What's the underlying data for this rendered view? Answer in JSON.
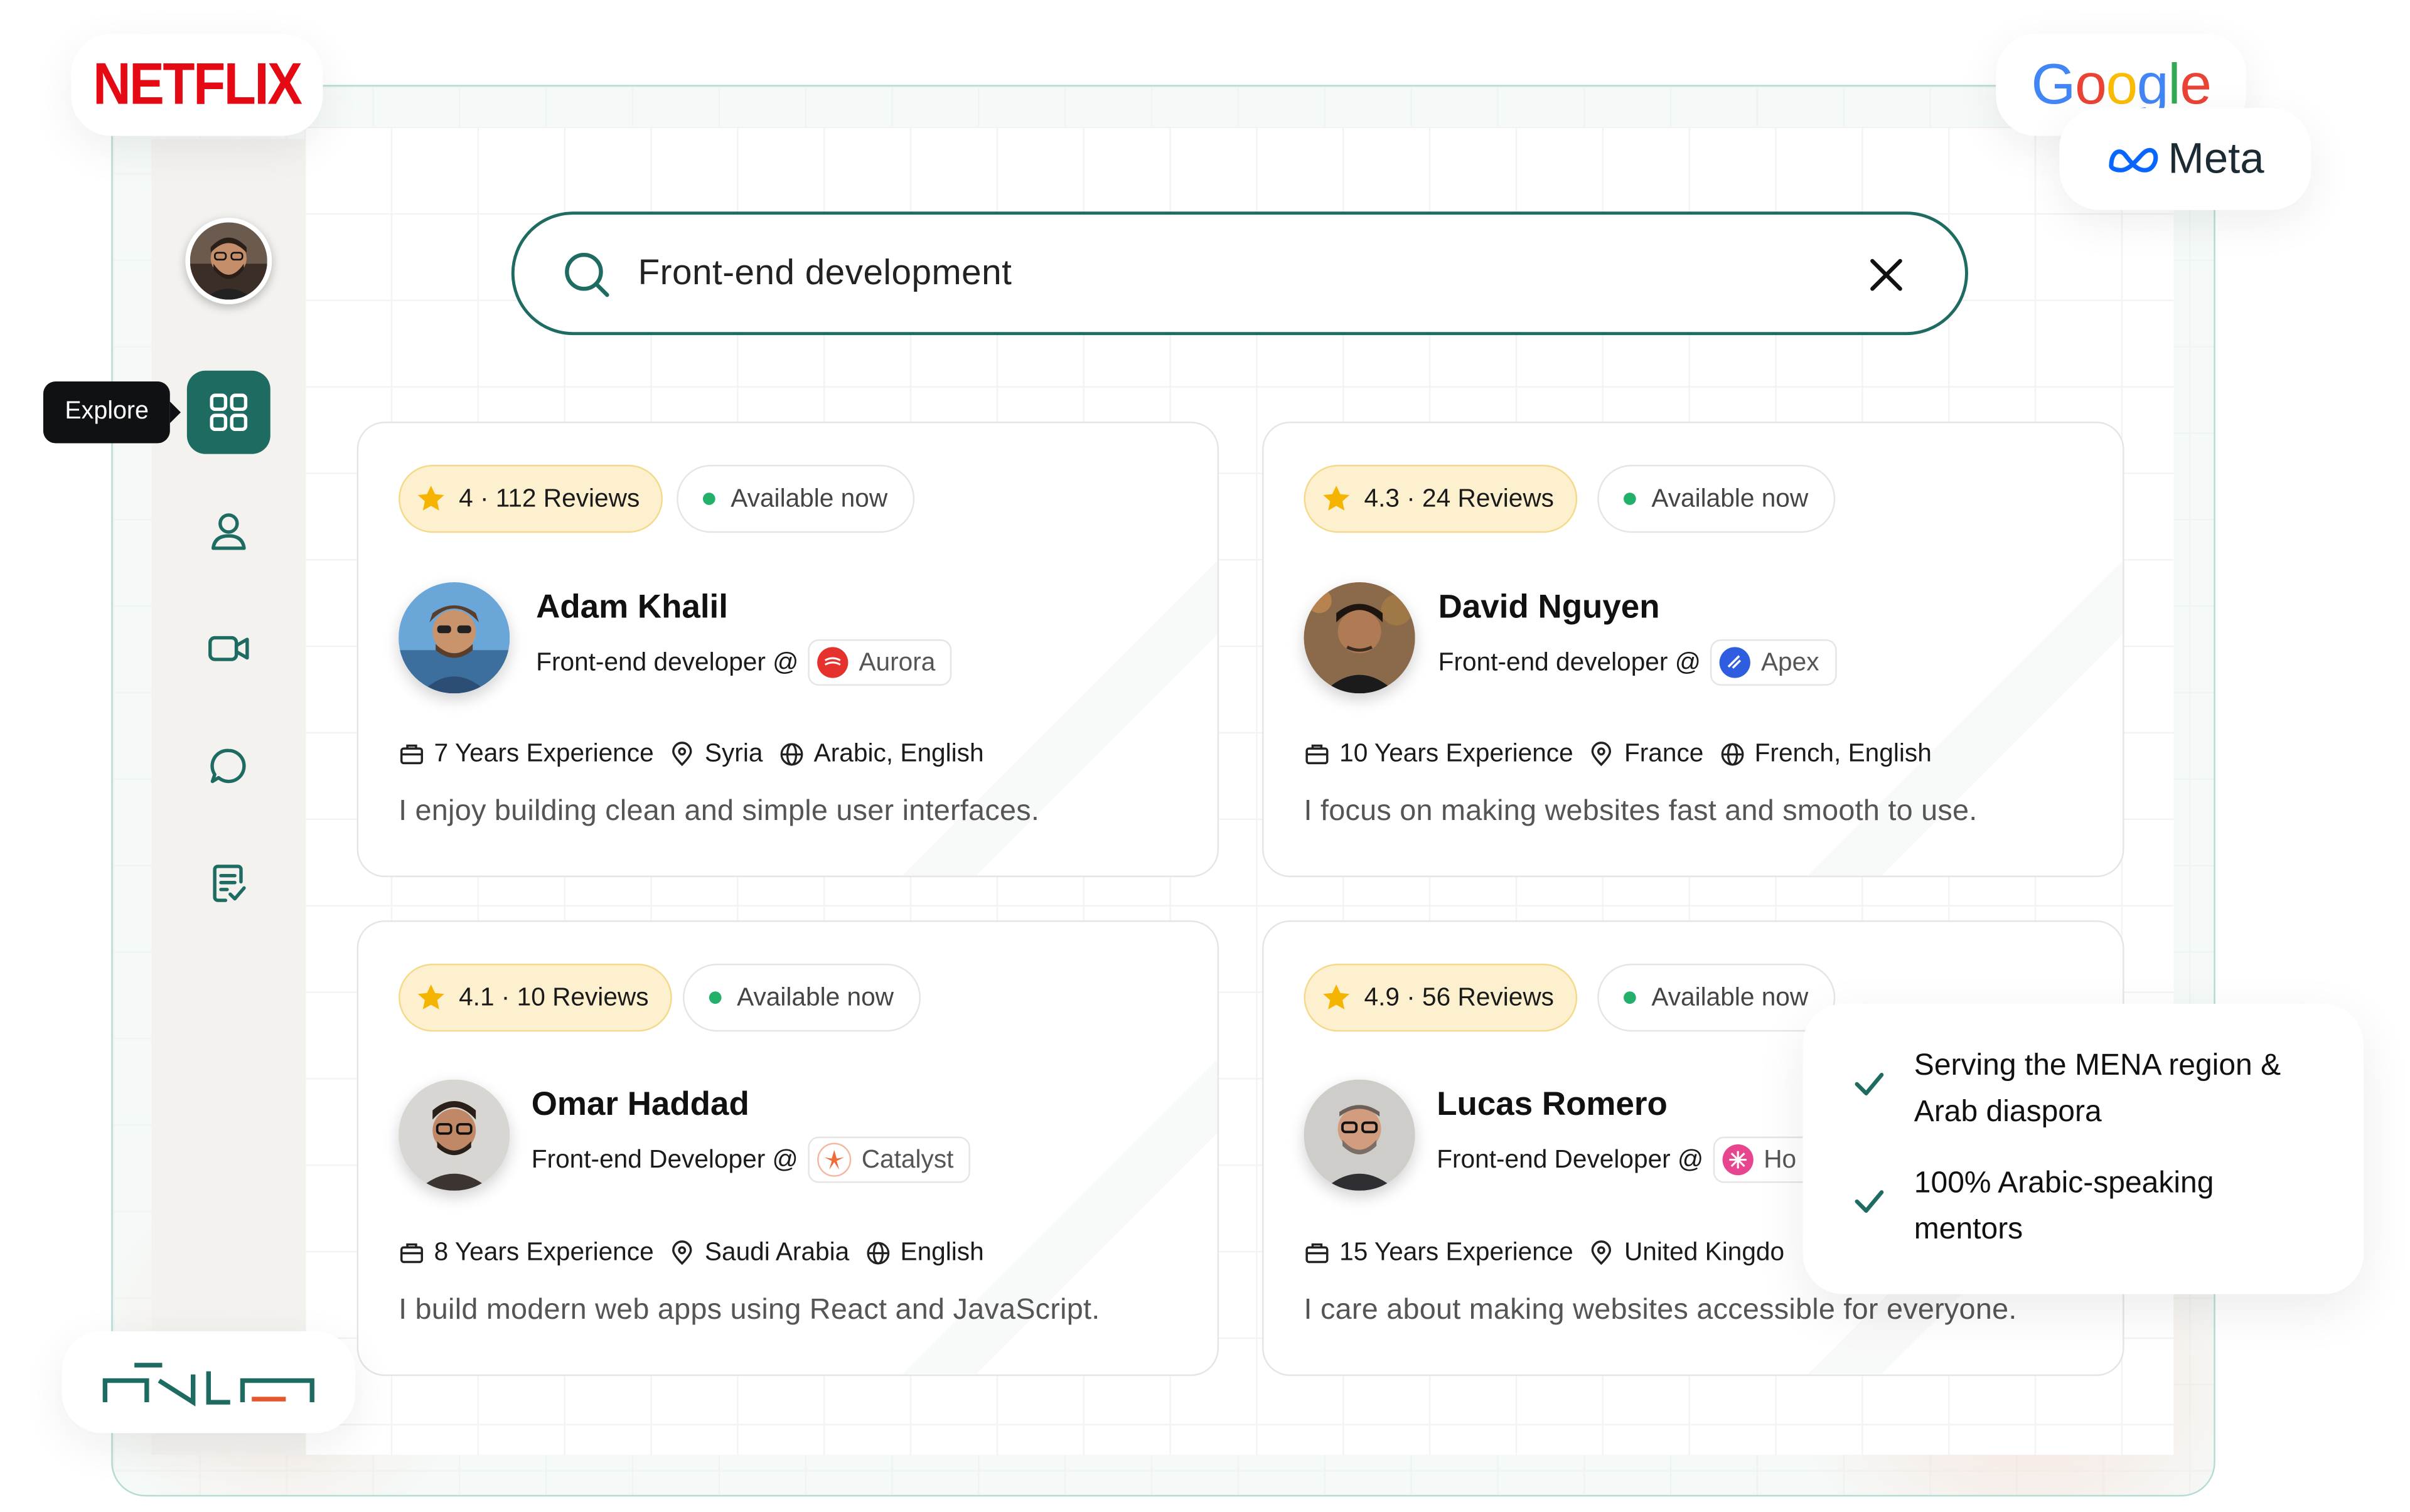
{
  "brand_logos": {
    "netflix": "NETFLIX",
    "google": "Google",
    "meta": "Meta"
  },
  "sidebar": {
    "tooltip": "Explore",
    "items": [
      {
        "name": "explore",
        "icon": "grid-icon",
        "active": true
      },
      {
        "name": "profile",
        "icon": "user-icon"
      },
      {
        "name": "sessions",
        "icon": "video-icon"
      },
      {
        "name": "messages",
        "icon": "chat-icon"
      },
      {
        "name": "notes",
        "icon": "document-check-icon"
      }
    ]
  },
  "search": {
    "value": "Front-end development"
  },
  "cards": [
    {
      "rating": "4 · 112 Reviews",
      "availability": "Available now",
      "name": "Adam Khalil",
      "role": "Front-end developer @",
      "company": "Aurora",
      "experience": "7 Years Experience",
      "location": "Syria",
      "languages": "Arabic, English",
      "bio": "I enjoy building clean and simple user interfaces."
    },
    {
      "rating": "4.3 · 24 Reviews",
      "availability": "Available now",
      "name": "David Nguyen",
      "role": "Front-end developer @",
      "company": "Apex",
      "experience": "10 Years Experience",
      "location": "France",
      "languages": "French, English",
      "bio": "I focus on making websites fast and smooth to use."
    },
    {
      "rating": "4.1 · 10 Reviews",
      "availability": "Available now",
      "name": "Omar Haddad",
      "role": "Front-end Developer @",
      "company": "Catalyst",
      "experience": "8 Years Experience",
      "location": "Saudi Arabia",
      "languages": "English",
      "bio": "I build modern web apps using React and JavaScript."
    },
    {
      "rating": "4.9 · 56 Reviews",
      "availability": "Available now",
      "name": "Lucas Romero",
      "role": "Front-end Developer @",
      "company": "Ho",
      "experience": "15 Years Experience",
      "location": "United Kingdo",
      "bio": "I care about making websites accessible for everyone."
    }
  ],
  "features": [
    "Serving the MENA region & Arab diaspora",
    "100% Arabic-speaking mentors"
  ],
  "colors": {
    "accent": "#1d6b61",
    "star": "#f5b400",
    "available": "#22b06b",
    "netflix": "#e50914"
  }
}
